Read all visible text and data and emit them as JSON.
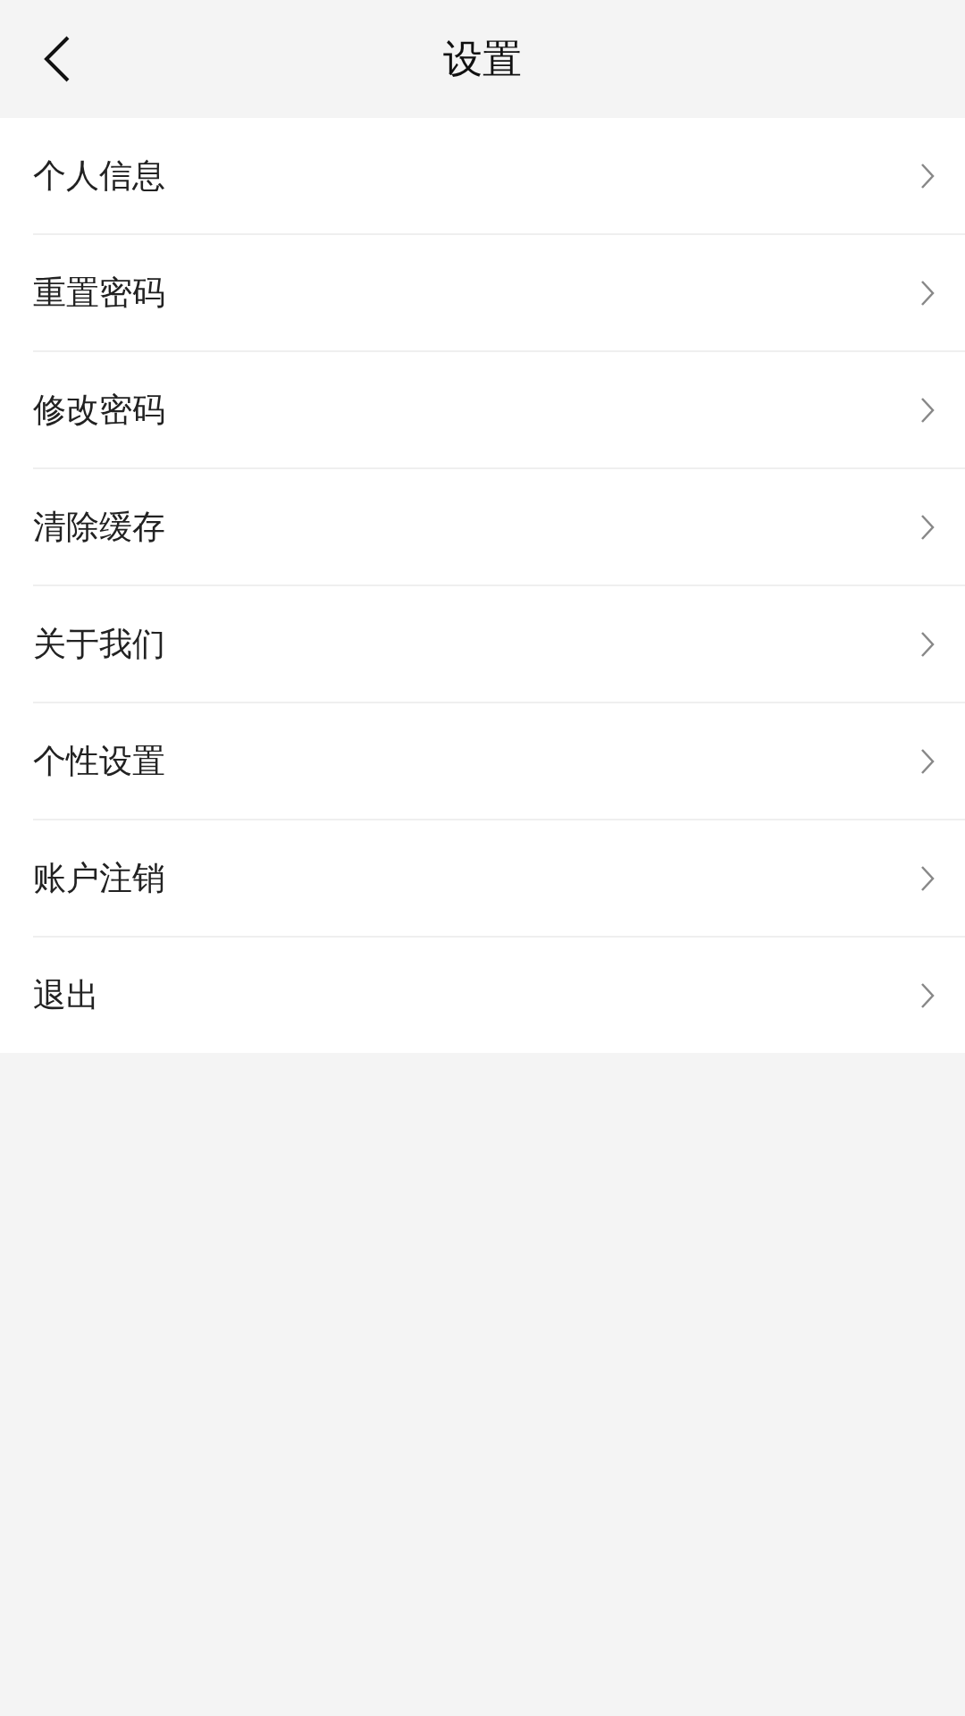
{
  "header": {
    "title": "设置"
  },
  "items": [
    {
      "label": "个人信息"
    },
    {
      "label": "重置密码"
    },
    {
      "label": "修改密码"
    },
    {
      "label": "清除缓存"
    },
    {
      "label": "关于我们"
    },
    {
      "label": "个性设置"
    },
    {
      "label": "账户注销"
    },
    {
      "label": "退出"
    }
  ]
}
